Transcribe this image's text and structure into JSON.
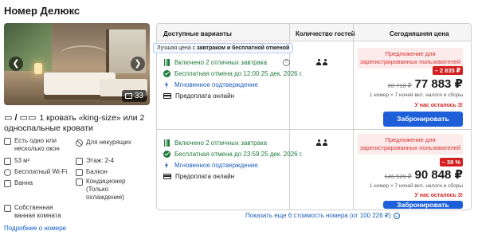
{
  "room": {
    "title": "Номер Делюкс",
    "photo_count": "33",
    "bed_text": "1 кровать «king-size» или 2 односпальные кровати",
    "more_link": "Подробнее о номере",
    "amenities": [
      "Есть одно или несколько окон",
      "Для некурящих",
      "53 м²",
      "Этаж: 2-4",
      "Бесплатный Wi-Fi",
      "Балкон",
      "Ванна",
      "Кондиционер (Только охлаждение)",
      "Собственная ванная комната"
    ]
  },
  "table": {
    "headers": {
      "options": "Доступные варианты",
      "guests": "Количество гостей",
      "price": "Сегодняшняя цена"
    },
    "tooltip": {
      "prefix": "Лучшая цена с ",
      "bold": "завтраком и бесплатной отменой"
    },
    "rows": [
      {
        "features": [
          "Включено 2 отличных завтрака",
          "Бесплатная отмена до 12:00 25 дек. 2026 г.",
          "Мгновенное подтверждение",
          "Предоплата онлайн"
        ],
        "promo": "Предложение для зарегистрированных пользователей",
        "discount": "– 2 835 ₽",
        "old_price": "80 718 ₽",
        "new_price": "77 883 ₽",
        "note": "1 номер × 7 ночей вкл. налоги и сборы",
        "left": "У нас осталось 3!",
        "button": "Забронировать"
      },
      {
        "features": [
          "Включено 2 отличных завтрака",
          "Бесплатная отмена до 23:59 25 дек. 2026 г.",
          "Мгновенное подтверждение",
          "Предоплата онлайн"
        ],
        "promo": "Предложение для зарегистрированных пользователей",
        "discount": "– 38 %",
        "old_price": "146 529 ₽",
        "new_price": "90 848 ₽",
        "note": "1 номер × 7 ночей вкл. налоги и сборы",
        "left": "У нас осталось 3!",
        "button": "Забронировать"
      }
    ]
  },
  "more_rates": "Показать еще 6 стоимость номера (от 100 226 ₽)",
  "colors": {
    "accent": "#1c5fd9",
    "discount": "#d42020",
    "green": "#1f7a3a"
  }
}
